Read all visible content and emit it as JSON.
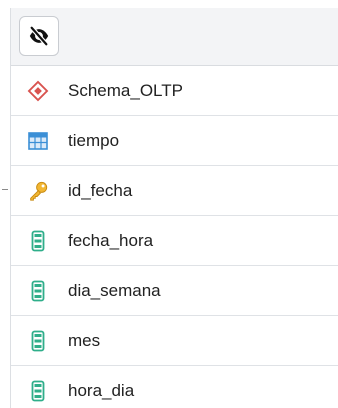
{
  "toolbar": {
    "toggle_icon": "eye-slash-icon"
  },
  "tree": {
    "items": [
      {
        "label": "Schema_OLTP",
        "icon": "schema-icon"
      },
      {
        "label": "tiempo",
        "icon": "table-icon"
      },
      {
        "label": "id_fecha",
        "icon": "primary-key-icon"
      },
      {
        "label": "fecha_hora",
        "icon": "column-icon"
      },
      {
        "label": "dia_semana",
        "icon": "column-icon"
      },
      {
        "label": "mes",
        "icon": "column-icon"
      },
      {
        "label": "hora_dia",
        "icon": "column-icon"
      }
    ]
  },
  "colors": {
    "schema": "#d9534f",
    "table": "#3b8fd6",
    "key": "#e0a21a",
    "column": "#2fae8a"
  }
}
